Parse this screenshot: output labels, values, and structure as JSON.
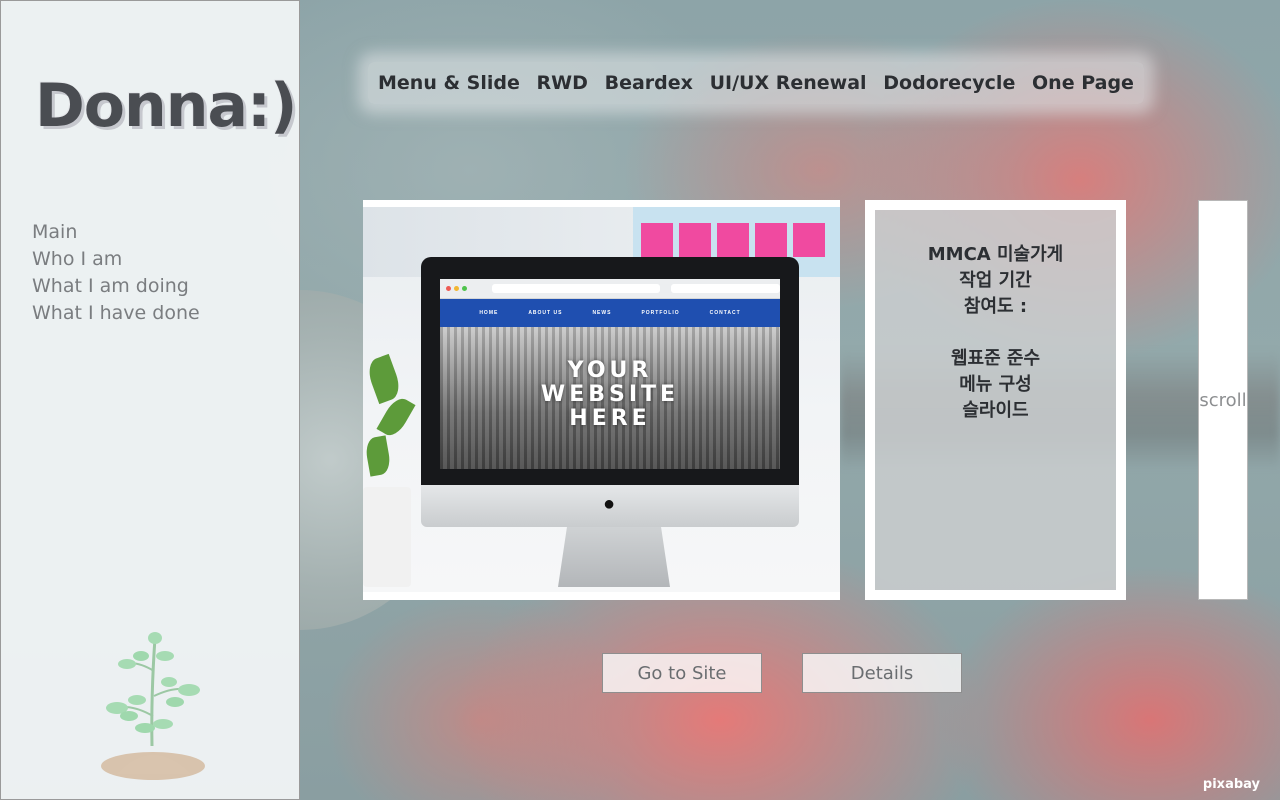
{
  "brand": {
    "logo_text": "Donna:)"
  },
  "sidebar": {
    "nav": [
      {
        "label": "Main"
      },
      {
        "label": "Who I am"
      },
      {
        "label": "What I am doing"
      },
      {
        "label": "What I have done"
      }
    ]
  },
  "top_menu": {
    "items": [
      {
        "label": "Menu & Slide"
      },
      {
        "label": "RWD"
      },
      {
        "label": "Beardex"
      },
      {
        "label": "UI/UX Renewal"
      },
      {
        "label": "Dodorecycle"
      },
      {
        "label": "One Page"
      }
    ]
  },
  "preview": {
    "site_nav": [
      "HOME",
      "ABOUT US",
      "NEWS",
      "PORTFOLIO",
      "CONTACT"
    ],
    "headline_lines": [
      "YOUR",
      "WEBSITE",
      "HERE"
    ]
  },
  "info": {
    "lines_top": [
      "MMCA 미술가게",
      "작업 기간",
      "참여도 :"
    ],
    "lines_bottom": [
      "웹표준 준수",
      "메뉴 구성",
      "슬라이드"
    ]
  },
  "scroll_label": "scroll",
  "buttons": {
    "go_to_site": "Go to Site",
    "details": "Details"
  },
  "credit": "pixabay",
  "colors": {
    "sidebar_bg": "#f3f6f7",
    "logo": "#4a4d52",
    "nav_text": "#7a7d80",
    "menu_text": "#2c2f33",
    "site_nav_blue": "#1f4fb0",
    "sticky_note": "#f04aa0"
  }
}
